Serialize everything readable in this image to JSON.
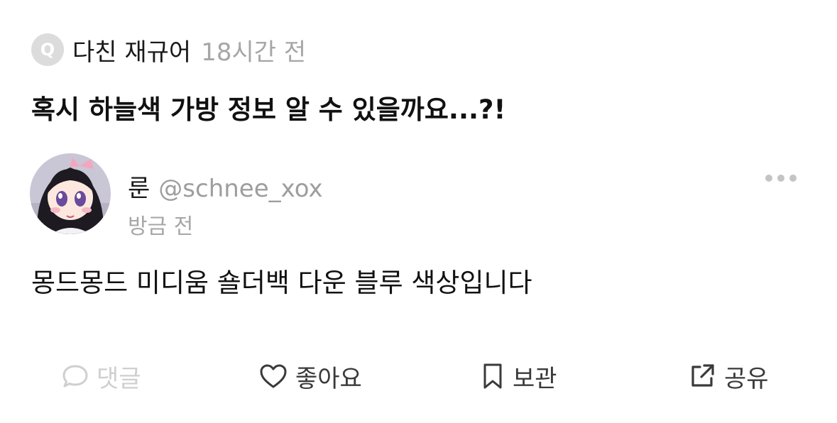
{
  "question": {
    "badge": "Q",
    "asker": "다친 재규어",
    "time": "18시간 전",
    "text": "혹시 하늘색 가방 정보 알 수 있을까요...?!"
  },
  "answer": {
    "name": "룬",
    "handle": "@schnee_xox",
    "time": "방금 전",
    "text": "몽드몽드 미디움 숄더백 다운 블루 색상입니다"
  },
  "actions": {
    "comment": "댓글",
    "like": "좋아요",
    "save": "보관",
    "share": "공유"
  },
  "colors": {
    "muted": "#a6a6a6",
    "disabled": "#cfcfcf",
    "icon": "#3a3a3a"
  }
}
